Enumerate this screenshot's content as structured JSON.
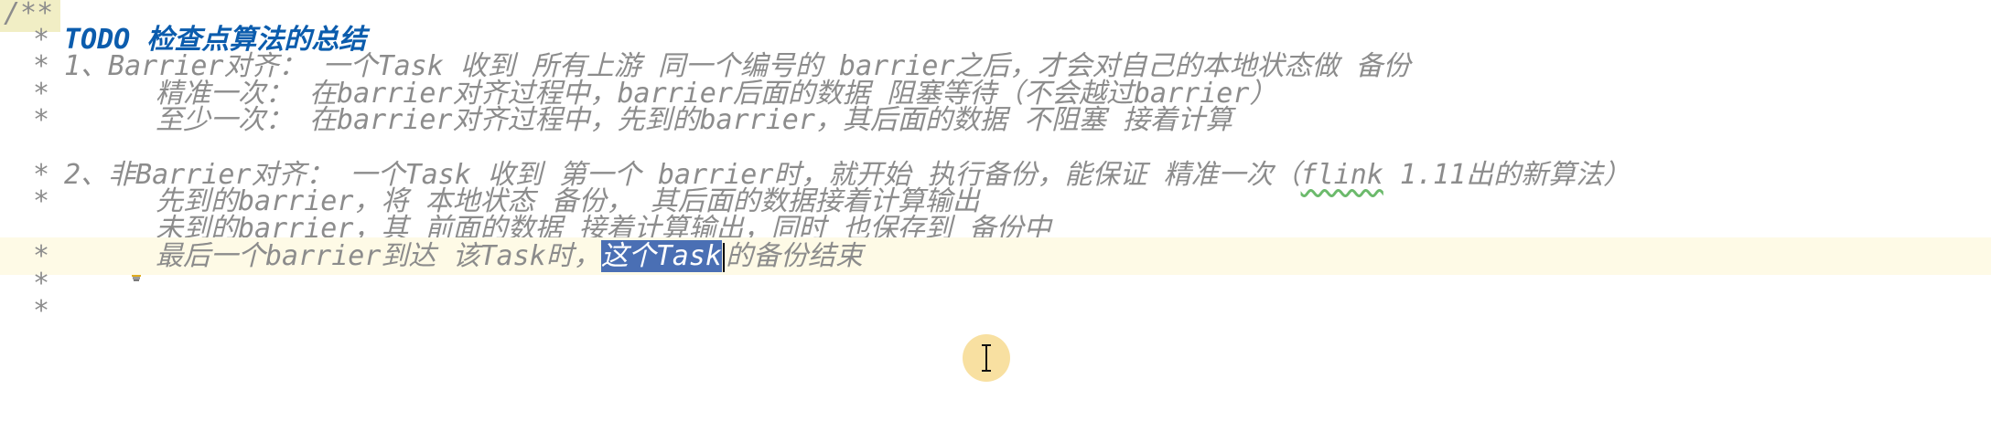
{
  "editor": {
    "comment_open": "/**",
    "star": "*",
    "todo_text": "TODO 检查点算法的总结",
    "lines": {
      "l1": "1、Barrier对齐： 一个Task 收到 所有上游 同一个编号的 barrier之后，才会对自己的本地状态做 备份",
      "l2": "精准一次： 在barrier对齐过程中，barrier后面的数据 阻塞等待（不会越过barrier）",
      "l3": "至少一次： 在barrier对齐过程中，先到的barrier，其后面的数据 不阻塞 接着计算",
      "l5_pre": "2、非Barrier对齐： 一个Task 收到 第一个 barrier时，就开始 执行备份，能保证 精准一次（",
      "l5_word": "flink",
      "l5_post": " 1.11出的新算法）",
      "l6": "先到的barrier，将 本地状态 备份， 其后面的数据接着计算输出",
      "l7": "未到的barrier，其 前面的数据 接着计算输出，同时 也保存到 备份中",
      "l8_pre": "最后一个barrier到达 该Task时，",
      "l8_sel": "这个Task",
      "l8_post": "的备份结束"
    }
  },
  "colors": {
    "comment": "#8c8c8c",
    "todo": "#0b5cad",
    "selection": "#4a6fb4",
    "current_line": "#fefae6",
    "comment_open_highlight": "#f1eec5"
  },
  "icons": {
    "gutter": "lightbulb-icon",
    "cursor": "text-cursor-icon"
  }
}
